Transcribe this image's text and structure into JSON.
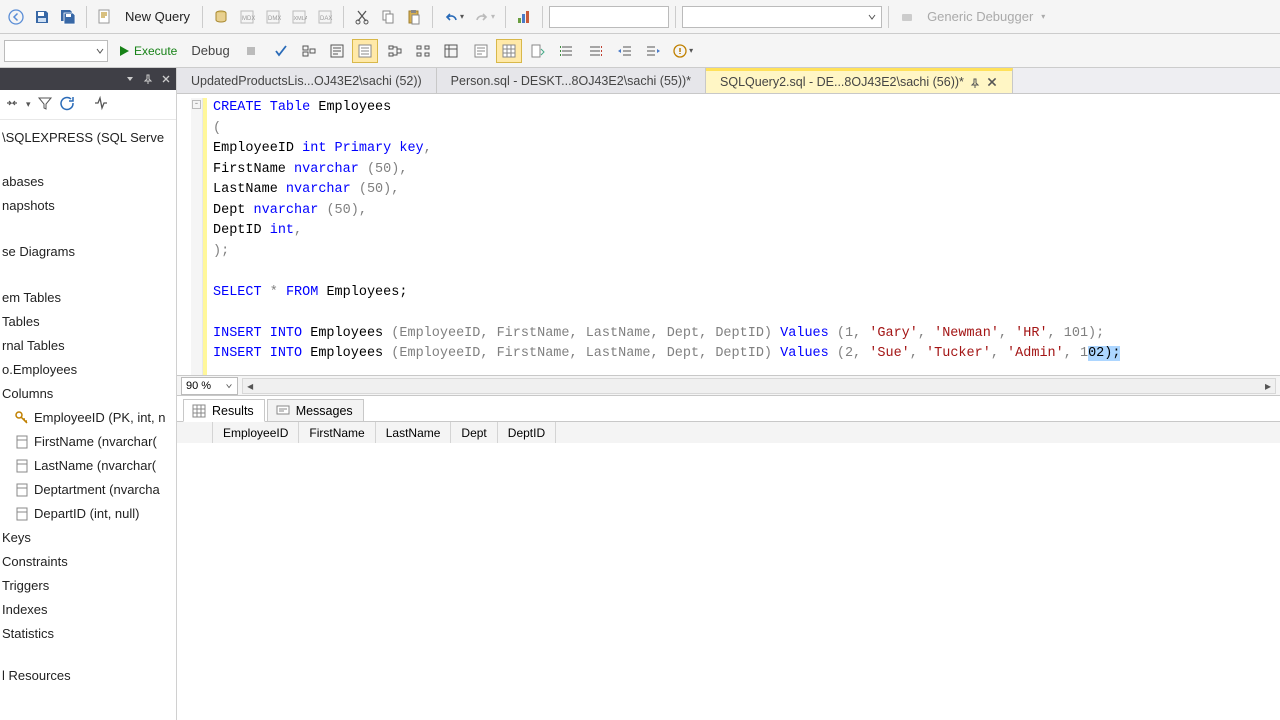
{
  "toolbar": {
    "new_query": "New Query",
    "debugger": "Generic Debugger",
    "execute": "Execute",
    "debug": "Debug"
  },
  "sidebar": {
    "server": "\\SQLEXPRESS (SQL Serve",
    "folders": [
      "abases",
      "napshots",
      "se Diagrams",
      "em Tables",
      "Tables",
      "rnal Tables",
      "o.Employees",
      "Columns"
    ],
    "columns": [
      "EmployeeID (PK, int, n",
      "FirstName (nvarchar(",
      "LastName (nvarchar(",
      "Deptartment (nvarcha",
      "DepartID (int, null)"
    ],
    "subfolders": [
      "Keys",
      "Constraints",
      "Triggers",
      "Indexes",
      "Statistics"
    ],
    "bottom": "l Resources"
  },
  "tabs": [
    {
      "label": "UpdatedProductsLis...OJ43E2\\sachi (52))"
    },
    {
      "label": "Person.sql - DESKT...8OJ43E2\\sachi (55))*"
    },
    {
      "label": "SQLQuery2.sql - DE...8OJ43E2\\sachi (56))*"
    }
  ],
  "zoom": "90 %",
  "result_tabs": {
    "results": "Results",
    "messages": "Messages"
  },
  "result_columns": [
    "EmployeeID",
    "FirstName",
    "LastName",
    "Dept",
    "DeptID"
  ],
  "sql": {
    "create_kw": "CREATE",
    "table_kw": "Table",
    "employees": "Employees",
    "lparen": "(",
    "col_eid": "EmployeeID",
    "int_kw": "int",
    "pk_kw": "Primary key",
    "comma": ",",
    "col_fn": "FirstName",
    "nvarchar_kw": "nvarchar",
    "fifty": "(50)",
    "col_ln": "LastName",
    "col_dept": "Dept",
    "col_did": "DeptID",
    "rparen_semi": ");",
    "select_kw": "SELECT",
    "star": "*",
    "from_kw": "FROM",
    "emp_semi": "Employees;",
    "insert_kw": "INSERT",
    "into_kw": "INTO",
    "cols_list": "(EmployeeID, FirstName, LastName, Dept, DeptID)",
    "values_kw": "Values",
    "row1_a": "(1,",
    "row1_gary": "'Gary'",
    "row1_newman": "'Newman'",
    "row1_hr": "'HR'",
    "row1_end": ", 101);",
    "row2_a": "(2,",
    "row2_sue": "'Sue'",
    "row2_tucker": "'Tucker'",
    "row2_admin": "'Admin'",
    "row2_pre": ", 1",
    "row2_hl": "02);"
  }
}
